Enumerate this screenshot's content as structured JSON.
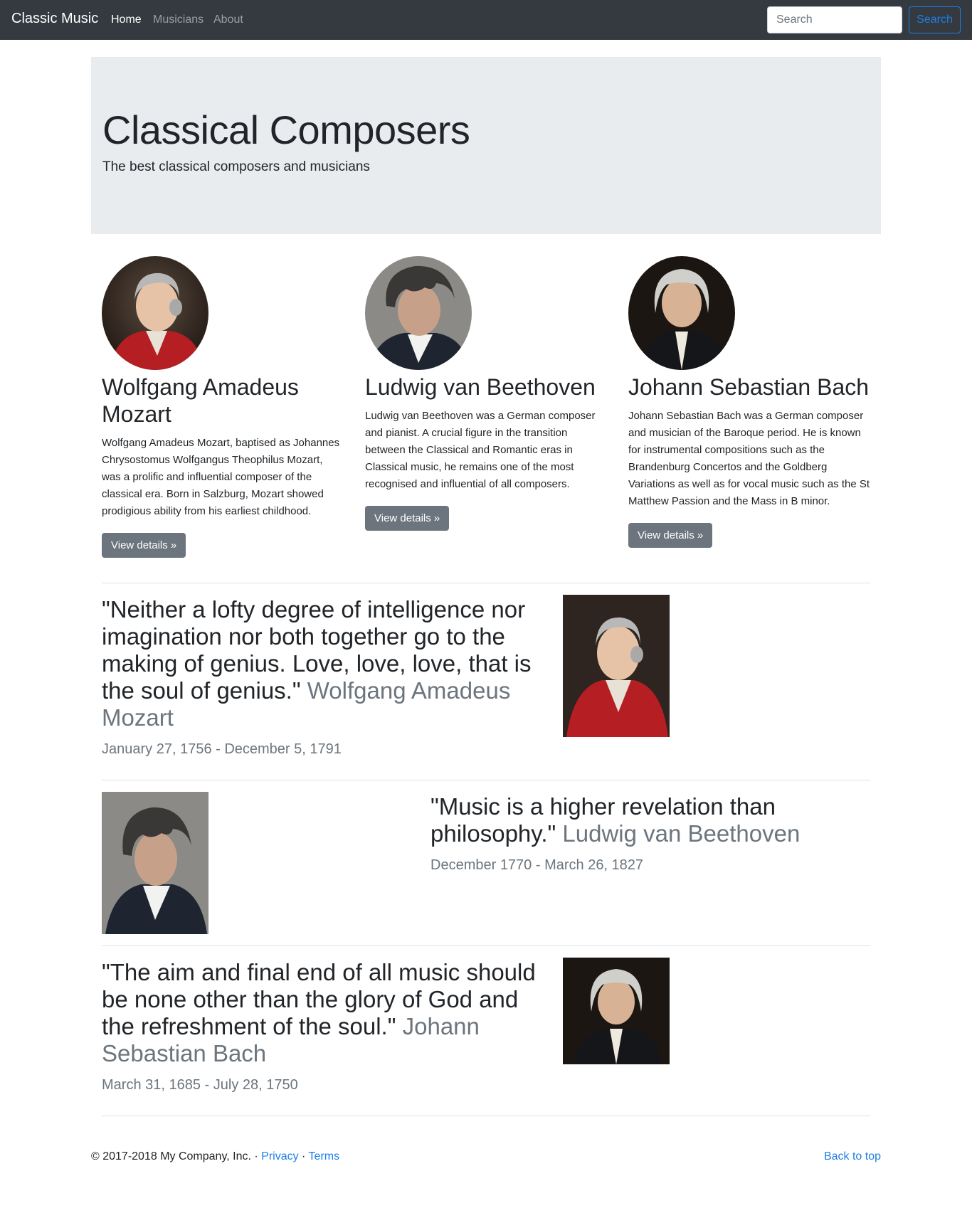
{
  "navbar": {
    "brand": "Classic Music",
    "links": [
      "Home",
      "Musicians",
      "About"
    ],
    "search_placeholder": "Search",
    "search_button": "Search"
  },
  "jumbotron": {
    "title": "Classical Composers",
    "subtitle": "The best classical composers and musicians"
  },
  "composers": [
    {
      "name": "Wolfgang Amadeus Mozart",
      "text": "Wolfgang Amadeus Mozart, baptised as Johannes Chrysostomus Wolfgangus Theophilus Mozart, was a prolific and influential composer of the classical era. Born in Salzburg, Mozart showed prodigious ability from his earliest childhood.",
      "button": "View details »"
    },
    {
      "name": "Ludwig van Beethoven",
      "text": "Ludwig van Beethoven was a German composer and pianist. A crucial figure in the transition between the Classical and Romantic eras in Classical music, he remains one of the most recognised and influential of all composers.",
      "button": "View details »"
    },
    {
      "name": "Johann Sebastian Bach",
      "text": "Johann Sebastian Bach was a German composer and musician of the Baroque period. He is known for instrumental compositions such as the Brandenburg Concertos and the Goldberg Variations as well as for vocal music such as the St Matthew Passion and the Mass in B minor.",
      "button": "View details »"
    }
  ],
  "quotes": [
    {
      "quote": "\"Neither a lofty degree of intelligence nor imagination nor both together go to the making of genius. Love, love, love, that is the soul of genius.\"",
      "author": "Wolfgang Amadeus Mozart",
      "dates": "January 27, 1756 - December 5, 1791"
    },
    {
      "quote": "\"Music is a higher revelation than philosophy.\"",
      "author": "Ludwig van Beethoven",
      "dates": "December 1770 - March 26, 1827"
    },
    {
      "quote": "\"The aim and final end of all music should be none other than the glory of God and the refreshment of the soul.\"",
      "author": "Johann Sebastian Bach",
      "dates": "March 31, 1685 - July 28, 1750"
    }
  ],
  "footer": {
    "copyright": "© 2017-2018 My Company, Inc. · ",
    "privacy": "Privacy",
    "separator": " · ",
    "terms": "Terms",
    "back_to_top": "Back to top"
  }
}
